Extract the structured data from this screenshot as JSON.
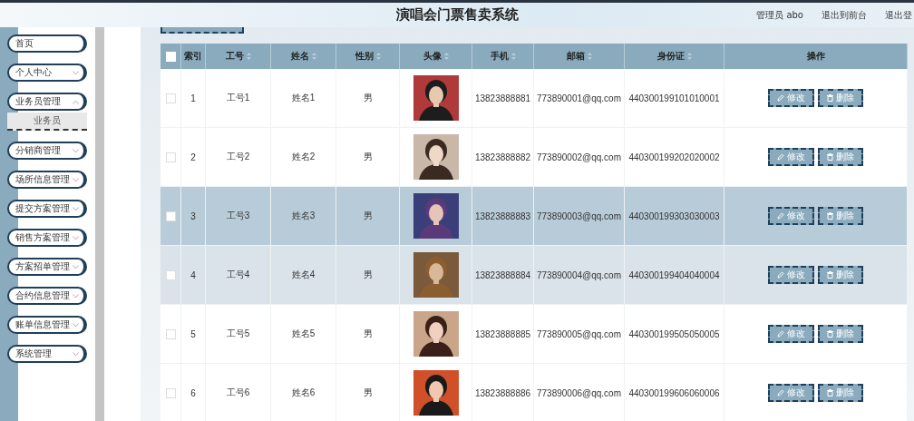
{
  "header": {
    "title": "演唱会门票售卖系统",
    "user": "管理员 abo",
    "links": [
      "退出到前台",
      "退出登"
    ]
  },
  "sidebar": {
    "items": [
      {
        "label": "首页",
        "kind": "link"
      },
      {
        "label": "个人中心",
        "kind": "menu",
        "expanded": false
      },
      {
        "label": "业务员管理",
        "kind": "menu",
        "expanded": true,
        "children": [
          {
            "label": "业务员"
          }
        ]
      },
      {
        "label": "分销商管理",
        "kind": "menu",
        "expanded": false
      },
      {
        "label": "场所信息管理",
        "kind": "menu",
        "expanded": false
      },
      {
        "label": "提交方案管理",
        "kind": "menu",
        "expanded": false
      },
      {
        "label": "销售方案管理",
        "kind": "menu",
        "expanded": false
      },
      {
        "label": "方案招单管理",
        "kind": "menu",
        "expanded": false
      },
      {
        "label": "合约信息管理",
        "kind": "menu",
        "expanded": false
      },
      {
        "label": "账单信息管理",
        "kind": "menu",
        "expanded": false
      },
      {
        "label": "系统管理",
        "kind": "menu",
        "expanded": false
      }
    ]
  },
  "table": {
    "select_all": {
      "checked": false
    },
    "columns": [
      {
        "label": "索引",
        "sortable": false
      },
      {
        "label": "工号",
        "sortable": true
      },
      {
        "label": "姓名",
        "sortable": true
      },
      {
        "label": "性别",
        "sortable": true
      },
      {
        "label": "头像",
        "sortable": true
      },
      {
        "label": "手机",
        "sortable": true
      },
      {
        "label": "邮箱",
        "sortable": true
      },
      {
        "label": "身份证",
        "sortable": true
      },
      {
        "label": "操作",
        "sortable": false
      }
    ],
    "rows": [
      {
        "index": "1",
        "id": "工号1",
        "name": "姓名1",
        "gender": "男",
        "phone": "13823888881",
        "email": "773890001@qq.com",
        "idcard": "440300199101010001",
        "selected": false,
        "hovered": false,
        "actions": [
          "修改",
          "删除"
        ]
      },
      {
        "index": "2",
        "id": "工号2",
        "name": "姓名2",
        "gender": "男",
        "phone": "13823888882",
        "email": "773890002@qq.com",
        "idcard": "440300199202020002",
        "selected": false,
        "hovered": false,
        "actions": [
          "修改",
          "删除"
        ]
      },
      {
        "index": "3",
        "id": "工号3",
        "name": "姓名3",
        "gender": "男",
        "phone": "13823888883",
        "email": "773890003@qq.com",
        "idcard": "440300199303030003",
        "selected": true,
        "hovered": false,
        "actions": [
          "修改",
          "删除"
        ]
      },
      {
        "index": "4",
        "id": "工号4",
        "name": "姓名4",
        "gender": "男",
        "phone": "13823888884",
        "email": "773890004@qq.com",
        "idcard": "440300199404040004",
        "selected": false,
        "hovered": true,
        "actions": [
          "修改",
          "删除"
        ]
      },
      {
        "index": "5",
        "id": "工号5",
        "name": "姓名5",
        "gender": "男",
        "phone": "13823888885",
        "email": "773890005@qq.com",
        "idcard": "440300199505050005",
        "selected": false,
        "hovered": false,
        "actions": [
          "修改",
          "删除"
        ]
      },
      {
        "index": "6",
        "id": "工号6",
        "name": "姓名6",
        "gender": "男",
        "phone": "13823888886",
        "email": "773890006@qq.com",
        "idcard": "440300199606060006",
        "selected": false,
        "hovered": false,
        "actions": [
          "修改",
          "删除"
        ]
      }
    ]
  }
}
